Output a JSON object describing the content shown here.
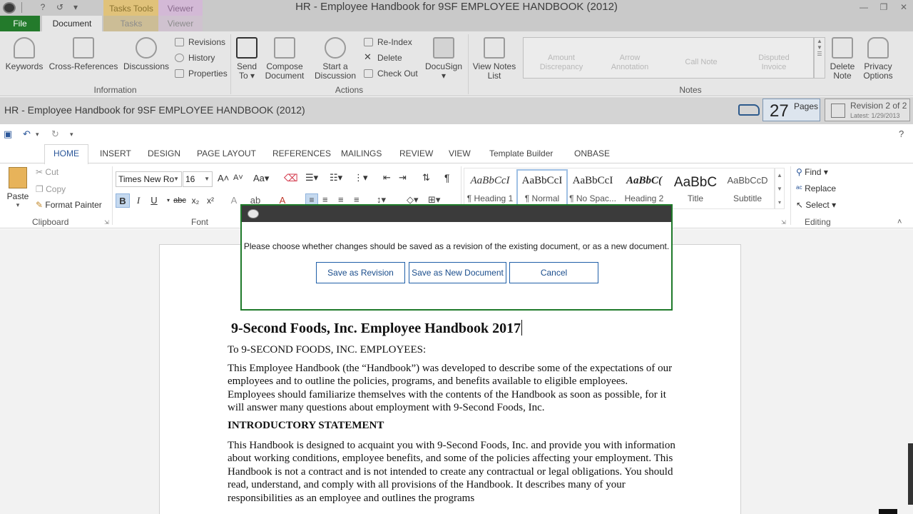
{
  "window": {
    "title": "HR - Employee Handbook for 9SF EMPLOYEE HANDBOOK (2012)",
    "contextual_groups": [
      "Tasks Tools",
      "Viewer"
    ]
  },
  "onbase_tabs": [
    "File",
    "Document",
    "Tasks",
    "Viewer"
  ],
  "onbase_ribbon": {
    "information": {
      "label": "Information",
      "keywords": "Keywords",
      "cross_references": "Cross-References",
      "discussions": "Discussions",
      "revisions": "Revisions",
      "history": "History",
      "properties": "Properties"
    },
    "actions": {
      "label": "Actions",
      "send_to": [
        "Send",
        "To"
      ],
      "compose": [
        "Compose",
        "Document"
      ],
      "start_discussion": [
        "Start a",
        "Discussion"
      ],
      "reindex": "Re-Index",
      "delete": "Delete",
      "check_out": "Check Out",
      "docusign": "DocuSign"
    },
    "notes": {
      "label": "Notes",
      "view_notes": [
        "View Notes",
        "List"
      ],
      "gallery": [
        [
          "Amount",
          "Discrepancy"
        ],
        [
          "Arrow",
          "Annotation"
        ],
        [
          "Call Note",
          ""
        ],
        [
          "Disputed",
          "Invoice"
        ]
      ],
      "delete_note": [
        "Delete",
        "Note"
      ],
      "privacy": [
        "Privacy",
        "Options"
      ]
    }
  },
  "doc_header": {
    "title": "HR - Employee Handbook for 9SF EMPLOYEE HANDBOOK (2012)",
    "page_count": "27",
    "page_count_label": "Pages",
    "revision": "Revision 2 of 2",
    "latest": "Latest: 1/29/2013"
  },
  "word_tabs": [
    "HOME",
    "INSERT",
    "DESIGN",
    "PAGE LAYOUT",
    "REFERENCES",
    "MAILINGS",
    "REVIEW",
    "VIEW",
    "Template Builder",
    "ONBASE"
  ],
  "word_ribbon": {
    "clipboard": {
      "label": "Clipboard",
      "paste": "Paste",
      "cut": "Cut",
      "copy": "Copy",
      "format_painter": "Format Painter"
    },
    "font": {
      "label": "Font",
      "font_name": "Times New Ro",
      "font_size": "16"
    },
    "styles": [
      {
        "sample": "AaBbCcI",
        "name": "¶ Heading 1"
      },
      {
        "sample": "AaBbCcI",
        "name": "¶ Normal"
      },
      {
        "sample": "AaBbCcI",
        "name": "¶ No Spac..."
      },
      {
        "sample": "AaBbC(",
        "name": "Heading 2"
      },
      {
        "sample": "AaBbC",
        "name": "Title"
      },
      {
        "sample": "AaBbCcD",
        "name": "Subtitle"
      }
    ],
    "editing": {
      "label": "Editing",
      "find": "Find",
      "replace": "Replace",
      "select": "Select"
    }
  },
  "document": {
    "title": "9-Second Foods, Inc. Employee Handbook 2017",
    "salutation": "To 9-SECOND FOODS, INC. EMPLOYEES:",
    "paragraph1": "This Employee Handbook (the “Handbook”) was developed to describe some of the expectations of our employees and to outline the policies, programs, and benefits available to eligible employees. Employees should familiarize themselves with the contents of the Handbook as soon as possible, for it will answer many questions about employment with 9-Second Foods, Inc.",
    "heading": "INTRODUCTORY STATEMENT",
    "paragraph2": "This Handbook is designed to acquaint you with 9-Second Foods, Inc. and provide you with information about working conditions, employee benefits, and some of the policies affecting your employment. This Handbook is not a contract and is not intended to create any contractual or legal obligations. You should read, understand, and comply with all provisions of the Handbook. It describes many of your responsibilities as an employee and outlines the programs"
  },
  "dialog": {
    "message": "Please choose whether changes should be saved as a revision of the existing document, or as a new document.",
    "save_revision": "Save as Revision",
    "save_new": "Save as New Document",
    "cancel": "Cancel"
  }
}
